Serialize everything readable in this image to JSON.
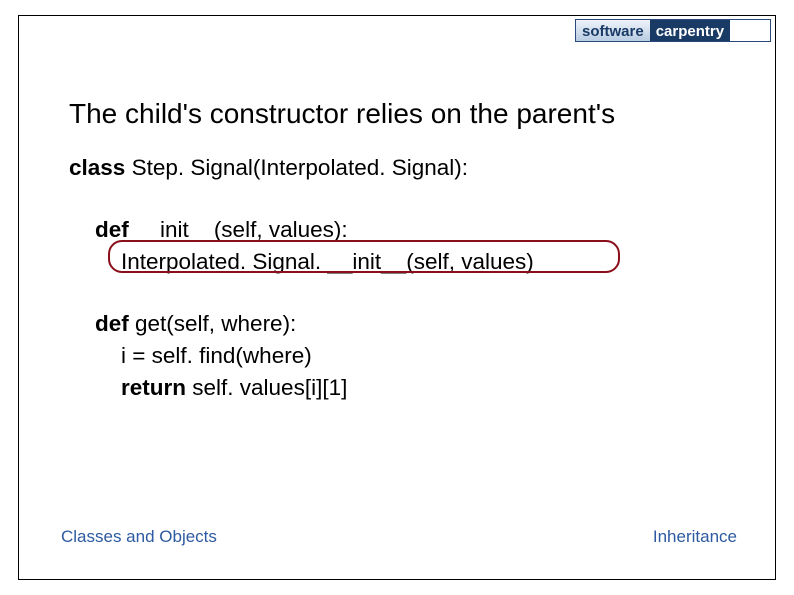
{
  "logo": {
    "left": "software",
    "right": "carpentry",
    "tagline": ""
  },
  "title": "The child's constructor relies on the parent's",
  "code": {
    "line1_kw": "class",
    "line1_rest": " Step. Signal(Interpolated. Signal):",
    "line2_kw": "def",
    "line2_rest": " __init__(self, values):",
    "line3": "Interpolated. Signal. __init__(self, values)",
    "line4_kw": "def",
    "line4_rest": " get(self, where):",
    "line5": "i = self. find(where)",
    "line6_kw": "return",
    "line6_rest": " self. values[i][1]"
  },
  "footer": {
    "left": "Classes and Objects",
    "right": "Inheritance"
  }
}
